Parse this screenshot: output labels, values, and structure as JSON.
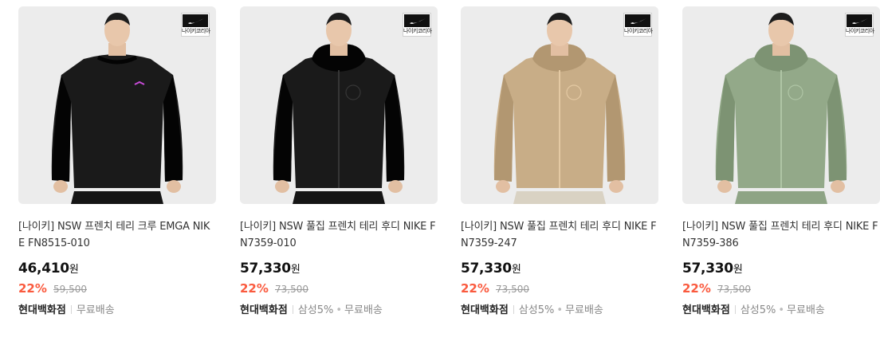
{
  "products": [
    {
      "title": "[나이키] NSW 프렌치 테리 크루 EMGA NIKE FN8515-010",
      "price": "46,410",
      "won": "원",
      "discount": "22%",
      "original_price": "59,500",
      "seller": "현대백화점",
      "tags": [
        "무료배송"
      ],
      "badge_text": "나이키코리아",
      "garment_color": "#1a1a1a",
      "garment_type": "crew-sweatshirt"
    },
    {
      "title": "[나이키] NSW 풀집 프렌치 테리 후디 NIKE FN7359-010",
      "price": "57,330",
      "won": "원",
      "discount": "22%",
      "original_price": "73,500",
      "seller": "현대백화점",
      "tags": [
        "삼성5%",
        "무료배송"
      ],
      "badge_text": "나이키코리아",
      "garment_color": "#1a1a1a",
      "garment_type": "zip-hoodie"
    },
    {
      "title": "[나이키] NSW 풀집 프렌치 테리 후디 NIKE FN7359-247",
      "price": "57,330",
      "won": "원",
      "discount": "22%",
      "original_price": "73,500",
      "seller": "현대백화점",
      "tags": [
        "삼성5%",
        "무료배송"
      ],
      "badge_text": "나이키코리아",
      "garment_color": "#c8ad87",
      "garment_type": "zip-hoodie"
    },
    {
      "title": "[나이키] NSW 풀집 프렌치 테리 후디 NIKE FN7359-386",
      "price": "57,330",
      "won": "원",
      "discount": "22%",
      "original_price": "73,500",
      "seller": "현대백화점",
      "tags": [
        "삼성5%",
        "무료배송"
      ],
      "badge_text": "나이키코리아",
      "garment_color": "#93a989",
      "garment_type": "zip-hoodie"
    }
  ],
  "colors": {
    "discount": "#fa5a3e",
    "price": "#111111",
    "original_price": "#999999",
    "thumbnail_bg": "#ececec"
  },
  "icons": {
    "brand_logo": "nike-swoosh-icon"
  }
}
